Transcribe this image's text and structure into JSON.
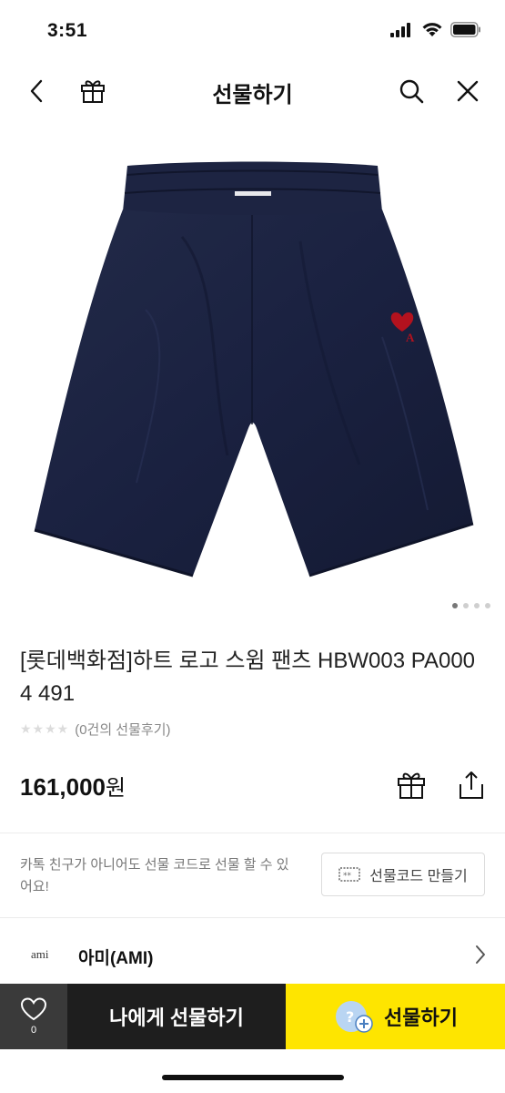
{
  "status": {
    "time": "3:51"
  },
  "nav": {
    "title": "선물하기",
    "icons": [
      "back-icon",
      "gift-icon",
      "search-icon",
      "close-icon"
    ]
  },
  "product": {
    "title": "[롯데백화점]하트 로고 스윔 팬츠 HBW003 PA0004 491",
    "review_text": "(0건의 선물후기)",
    "stars": "★★★★",
    "price": "161,000",
    "price_unit": "원",
    "image_pager": {
      "total": 4,
      "active": 1
    }
  },
  "gift_code": {
    "description": "카톡 친구가 아니어도 선물 코드로 선물 할 수 있어요!",
    "button_label": "선물코드 만들기"
  },
  "brand": {
    "logo_text": "ami",
    "name": "아미(AMI)"
  },
  "bottom_bar": {
    "wish_count": "0",
    "gift_self_label": "나에게 선물하기",
    "gift_label": "선물하기"
  },
  "colors": {
    "accent_yellow": "#fee500",
    "dark_button": "#1e1e1e",
    "wish_button": "#3a3a3a",
    "shorts_navy": "#1c2340",
    "heart_logo": "#b3121e"
  }
}
